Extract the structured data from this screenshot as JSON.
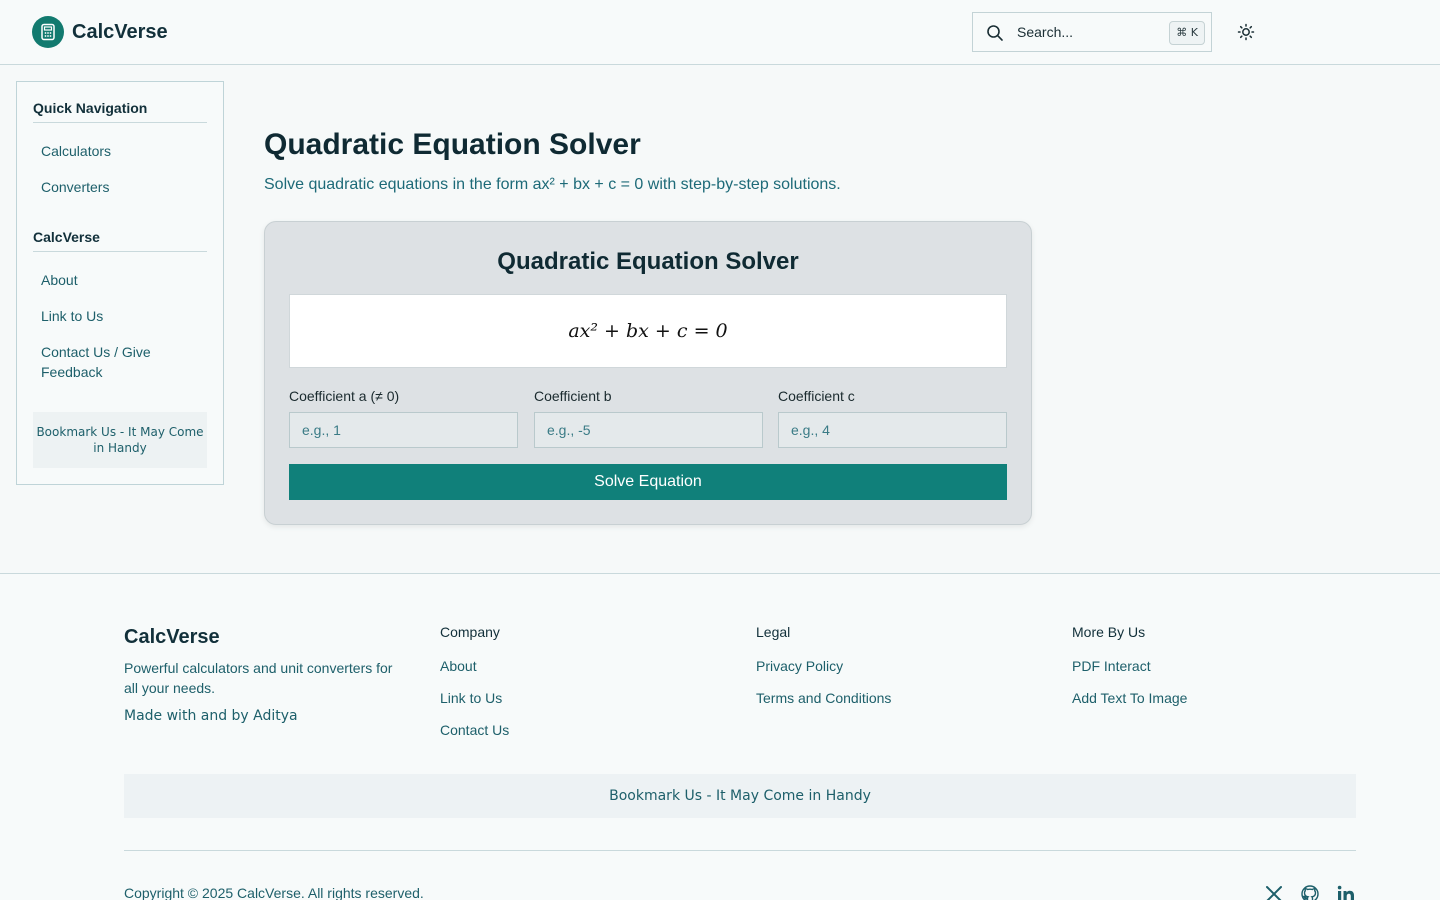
{
  "header": {
    "brand": "CalcVerse",
    "search_placeholder": "Search...",
    "search_shortcut": "⌘ K"
  },
  "sidebar": {
    "section1_title": "Quick Navigation",
    "section1_items": [
      "Calculators",
      "Converters"
    ],
    "section2_title": "CalcVerse",
    "section2_items": [
      "About",
      "Link to Us",
      "Contact Us / Give Feedback"
    ],
    "bookmark": " Bookmark Us - It May Come in Handy"
  },
  "main": {
    "title": "Quadratic Equation Solver",
    "subtitle": "Solve quadratic equations in the form ax² + bx + c = 0 with step-by-step solutions.",
    "card_title": "Quadratic Equation Solver",
    "formula": "ax² + bx + c = 0",
    "fields": [
      {
        "label": "Coefficient a (≠ 0)",
        "placeholder": "e.g., 1"
      },
      {
        "label": "Coefficient b",
        "placeholder": "e.g., -5"
      },
      {
        "label": "Coefficient c",
        "placeholder": "e.g., 4"
      }
    ],
    "solve_label": "Solve Equation"
  },
  "footer": {
    "brand": "CalcVerse",
    "description": "Powerful calculators and unit converters for all your needs.",
    "made_with": "Made with  and  by Aditya",
    "columns": [
      {
        "heading": "Company",
        "links": [
          "About",
          "Link to Us",
          "Contact Us"
        ]
      },
      {
        "heading": "Legal",
        "links": [
          "Privacy Policy",
          "Terms and Conditions"
        ]
      },
      {
        "heading": "More By Us",
        "links": [
          "PDF Interact",
          "Add Text To Image"
        ]
      }
    ],
    "bookmark": " Bookmark Us - It May Come in Handy",
    "copyright": "Copyright © 2025 CalcVerse. All rights reserved.",
    "social_icons": [
      "x-icon",
      "github-icon",
      "linkedin-icon"
    ]
  },
  "colors": {
    "accent": "#10807a",
    "link": "#1d5f6a",
    "background": "#f6f9f9"
  }
}
